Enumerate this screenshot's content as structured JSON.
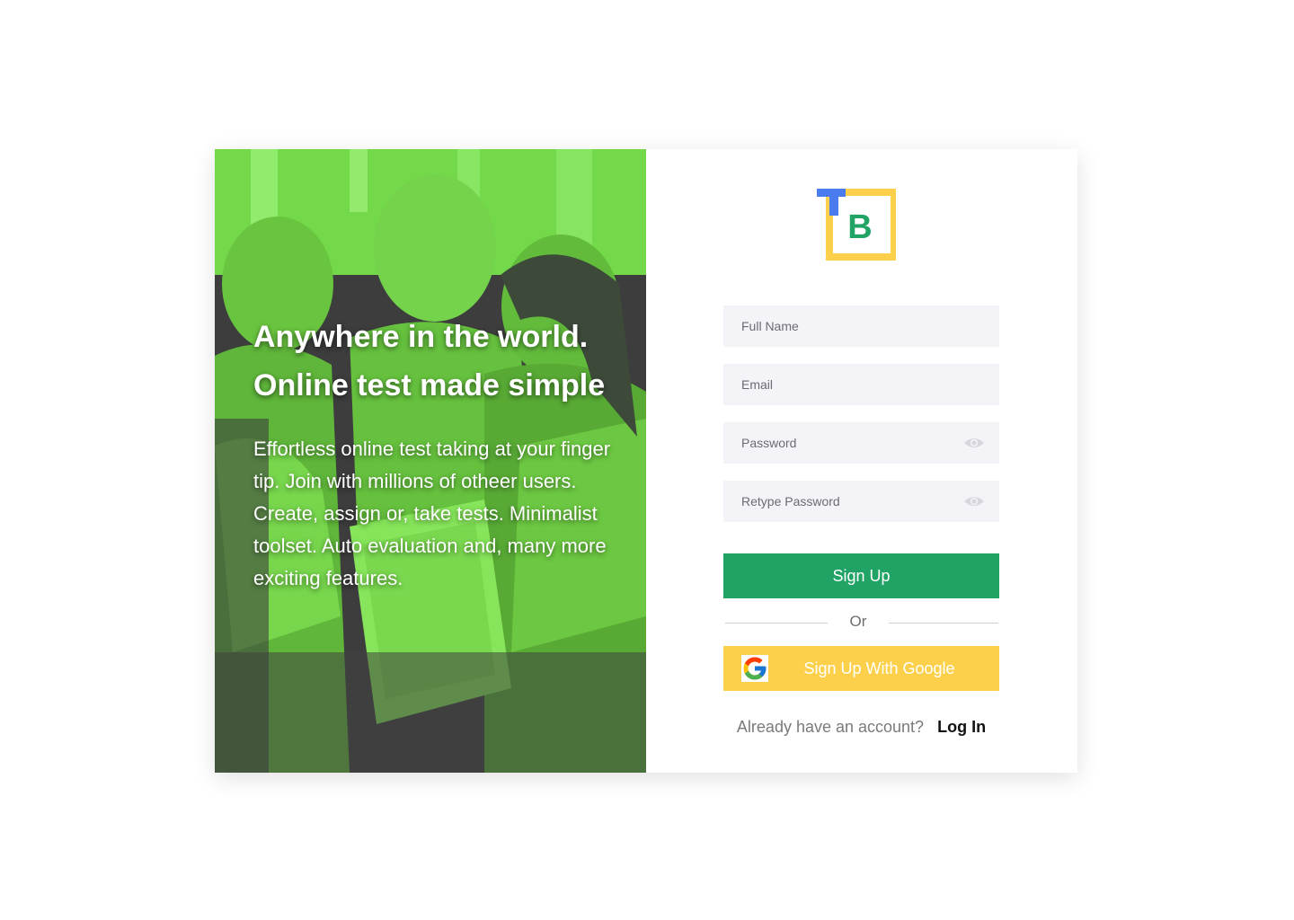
{
  "hero": {
    "title_line1": "Anywhere in the world.",
    "title_line2": "Online test made simple",
    "description": "Effortless online test taking at your finger tip. Join with millions of otheer users. Create, assign or, take tests. Minimalist toolset. Auto evaluation and, many more exciting features.",
    "overlay_color": "#7be04f"
  },
  "logo": {
    "letter_t": "T",
    "letter_b": "B",
    "colors": {
      "t": "#4a7cf0",
      "frame": "#fdd04c",
      "b": "#21a366"
    }
  },
  "form": {
    "full_name": {
      "placeholder": "Full Name",
      "value": ""
    },
    "email": {
      "placeholder": "Email",
      "value": ""
    },
    "password": {
      "placeholder": "Password",
      "value": "",
      "toggle_icon": "eye-icon"
    },
    "retype_password": {
      "placeholder": "Retype Password",
      "value": "",
      "toggle_icon": "eye-icon"
    },
    "signup_label": "Sign Up",
    "divider_label": "Or",
    "google_label": "Sign Up With Google",
    "google_icon": "google-g-icon"
  },
  "login": {
    "question": "Already have an account?",
    "link_label": "Log In"
  },
  "colors": {
    "primary_green": "#21a366",
    "google_yellow": "#fdd04c",
    "field_bg": "#f3f3f8"
  }
}
